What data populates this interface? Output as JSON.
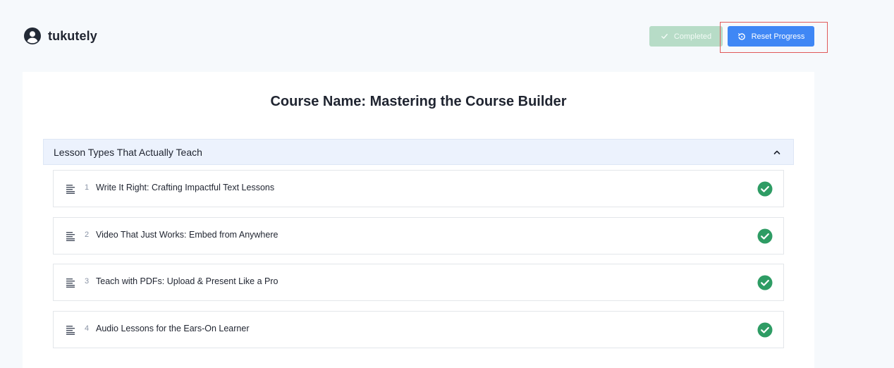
{
  "brand": {
    "name": "tukutely",
    "icon": "user-circle-icon"
  },
  "actions": {
    "completed_label": "Completed",
    "completed_icon": "check-icon",
    "reset_label": "Reset Progress",
    "reset_icon": "reset-icon"
  },
  "course": {
    "title": "Course Name: Mastering the Course Builder"
  },
  "section": {
    "title": "Lesson Types That Actually Teach",
    "expanded": true,
    "lessons": [
      {
        "number": "1",
        "title": "Write It Right: Crafting Impactful Text Lessons",
        "completed": true
      },
      {
        "number": "2",
        "title": "Video That Just Works: Embed from Anywhere",
        "completed": true
      },
      {
        "number": "3",
        "title": "Teach with PDFs: Upload & Present Like a Pro",
        "completed": true
      },
      {
        "number": "4",
        "title": "Audio Lessons for the Ears-On Learner",
        "completed": true
      }
    ]
  },
  "colors": {
    "accent": "#3f87f5",
    "completed_bg": "#b7dcc7",
    "check_green": "#2e9c64",
    "highlight": "#e05a5a"
  }
}
